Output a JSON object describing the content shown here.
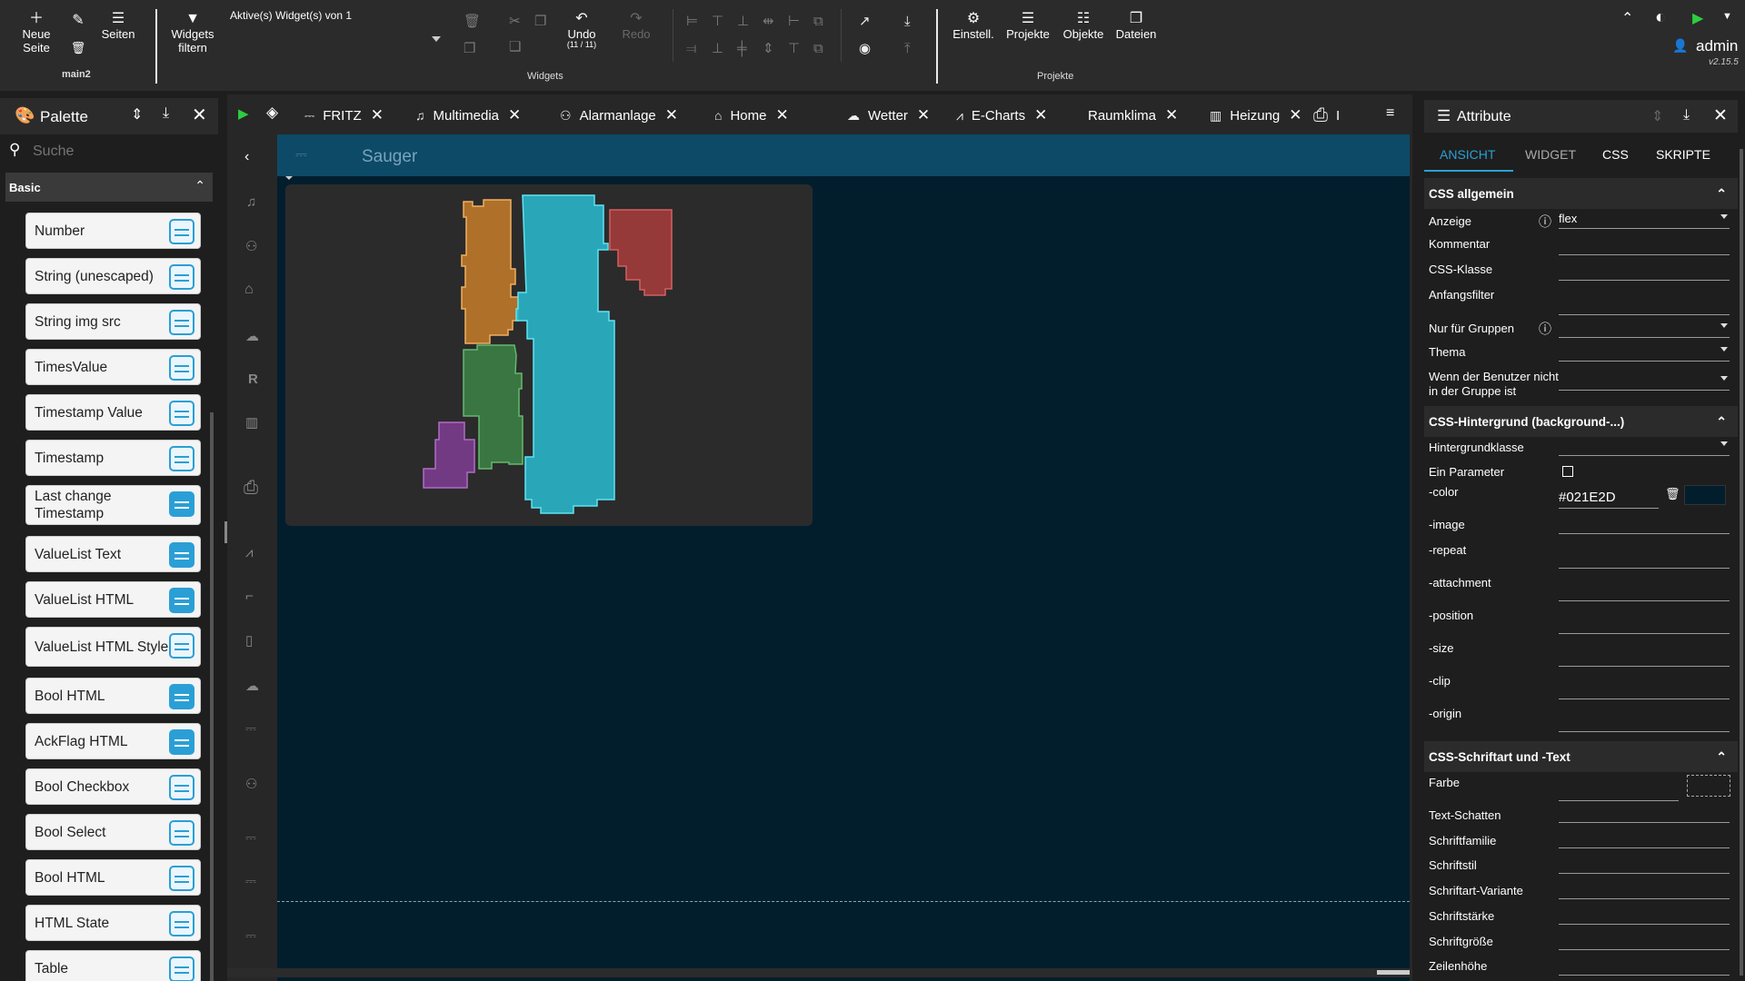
{
  "toolbar": {
    "new_page": "Neue Seite",
    "page_name": "main2",
    "pages": "Seiten",
    "widgets_filter_l1": "Widgets",
    "widgets_filter_l2": "filtern",
    "active_widgets": "Aktive(s) Widget(s) von 1",
    "undo": "Undo",
    "undo_count": "(11 / 11)",
    "redo": "Redo",
    "group_widgets": "Widgets",
    "settings": "Einstell.",
    "projects": "Projekte",
    "objects": "Objekte",
    "files": "Dateien",
    "group_projects": "Projekte",
    "user": "admin",
    "version": "v2.15.5"
  },
  "palette": {
    "title": "Palette",
    "search_placeholder": "Suche",
    "category": "Basic",
    "items": [
      "Number",
      "String (unescaped)",
      "String img src",
      "TimesValue",
      "Timestamp Value",
      "Timestamp",
      "Last change Timestamp",
      "ValueList Text",
      "ValueList HTML",
      "ValueList HTML Style",
      "Bool HTML",
      "AckFlag HTML",
      "Bool Checkbox",
      "Bool Select",
      "Bool HTML",
      "HTML State",
      "Table"
    ]
  },
  "tabs": [
    {
      "label": "FRITZ",
      "icon": "fritz-icon"
    },
    {
      "label": "Multimedia",
      "icon": "music-note-icon"
    },
    {
      "label": "Alarmanlage",
      "icon": "alarm-icon"
    },
    {
      "label": "Home",
      "icon": "home-icon"
    },
    {
      "label": "Wetter",
      "icon": "weather-icon"
    },
    {
      "label": "E-Charts",
      "icon": "chart-icon"
    },
    {
      "label": "Raumklima",
      "icon": ""
    },
    {
      "label": "Heizung",
      "icon": "radiator-icon"
    },
    {
      "label": "I",
      "icon": "printer-icon"
    }
  ],
  "canvas": {
    "title": "Sauger",
    "background": "#021E2D",
    "rooms": [
      {
        "name": "orange-room",
        "color": "#e8a24a"
      },
      {
        "name": "cyan-room",
        "color": "#2fd2e8"
      },
      {
        "name": "red-room",
        "color": "#c04848"
      },
      {
        "name": "green-room",
        "color": "#3f9a4e"
      },
      {
        "name": "purple-room",
        "color": "#9b4fae"
      }
    ]
  },
  "attributes": {
    "title": "Attribute",
    "tabs": [
      "ANSICHT",
      "WIDGET",
      "CSS",
      "SKRIPTE"
    ],
    "active_tab": "ANSICHT",
    "sec_general": "CSS allgemein",
    "display_label": "Anzeige",
    "display_value": "flex",
    "comment_label": "Kommentar",
    "css_class_label": "CSS-Klasse",
    "initial_filter_label": "Anfangsfilter",
    "only_groups_label": "Nur für Gruppen",
    "theme_label": "Thema",
    "not_in_group_l1": "Wenn der Benutzer nicht",
    "not_in_group_l2": "in der Gruppe ist",
    "sec_background": "CSS-Hintergrund (background-...)",
    "bg_class_label": "Hintergrundklasse",
    "one_param_label": "Ein Parameter",
    "color_label": "-color",
    "color_value": "#021E2D",
    "image_label": "-image",
    "repeat_label": "-repeat",
    "attachment_label": "-attachment",
    "position_label": "-position",
    "size_label": "-size",
    "clip_label": "-clip",
    "origin_label": "-origin",
    "sec_font": "CSS-Schriftart und -Text",
    "color2_label": "Farbe",
    "text_shadow_label": "Text-Schatten",
    "font_family_label": "Schriftfamilie",
    "font_style_label": "Schriftstil",
    "font_variant_label": "Schriftart-Variante",
    "font_weight_label": "Schriftstärke",
    "font_size_label": "Schriftgröße",
    "line_height_label": "Zeilenhöhe"
  },
  "colors": {
    "accent": "#2a9fd6",
    "play": "#2ecc40",
    "canvas_bg": "#021e2d",
    "header_bar": "#0c4a68"
  }
}
